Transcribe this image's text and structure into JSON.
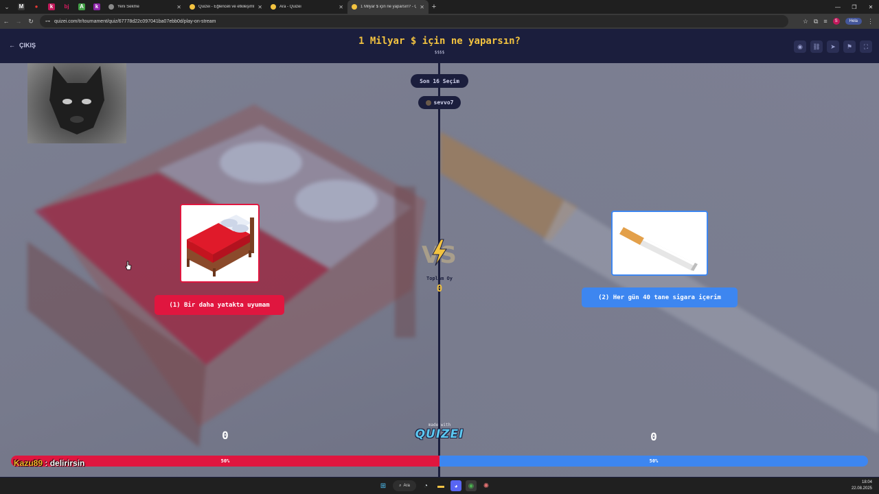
{
  "browser": {
    "pinned_tabs": [
      {
        "glyph": "M",
        "color": "#3b3b3b"
      },
      {
        "glyph": "●",
        "color": "#e53935"
      },
      {
        "glyph": "k",
        "color": "#c2185b"
      },
      {
        "glyph": "bj",
        "color": "#d81b60"
      },
      {
        "glyph": "A",
        "color": "#43a047"
      },
      {
        "glyph": "k",
        "color": "#8e24aa"
      }
    ],
    "tabs": [
      {
        "title": "Yeni Sekme",
        "active": false
      },
      {
        "title": "Quizei - Eğlenceli ve etkileşimli",
        "active": false
      },
      {
        "title": "Ara - Quizei",
        "active": false
      },
      {
        "title": "1 Milyar $ için ne yaparsın? - Q",
        "active": true
      }
    ],
    "url": "quizei.com/tr/tournament/quiz/67778d22c097041ba07ebb0d/play-on-stream",
    "profile_label": "Hela",
    "profile_initial": "S"
  },
  "quiz": {
    "exit_label": "ÇIKIŞ",
    "title": "1 Milyar $ için ne yaparsın?",
    "subtitle": "$$$$",
    "round_label": "Son 16 Seçim",
    "creator": "sevvo7",
    "total_label": "Toplam Oy",
    "total_value": "0",
    "made_with": "made with",
    "brand": "QUIZEI",
    "left": {
      "label": "(1) Bir daha yatakta uyumam",
      "count": "0",
      "percent_label": "50%",
      "percent": 50,
      "color": "#e0163f"
    },
    "right": {
      "label": "(2) Her gün 40 tane sigara içerim",
      "count": "0",
      "percent_label": "50%",
      "percent": 50,
      "color": "#3d86f0"
    }
  },
  "chat": {
    "user": "Kazu89",
    "separator": " : ",
    "message": "delirirsin"
  },
  "taskbar": {
    "search_label": "Ara",
    "time": "18:04",
    "date": "22.08.2025"
  }
}
